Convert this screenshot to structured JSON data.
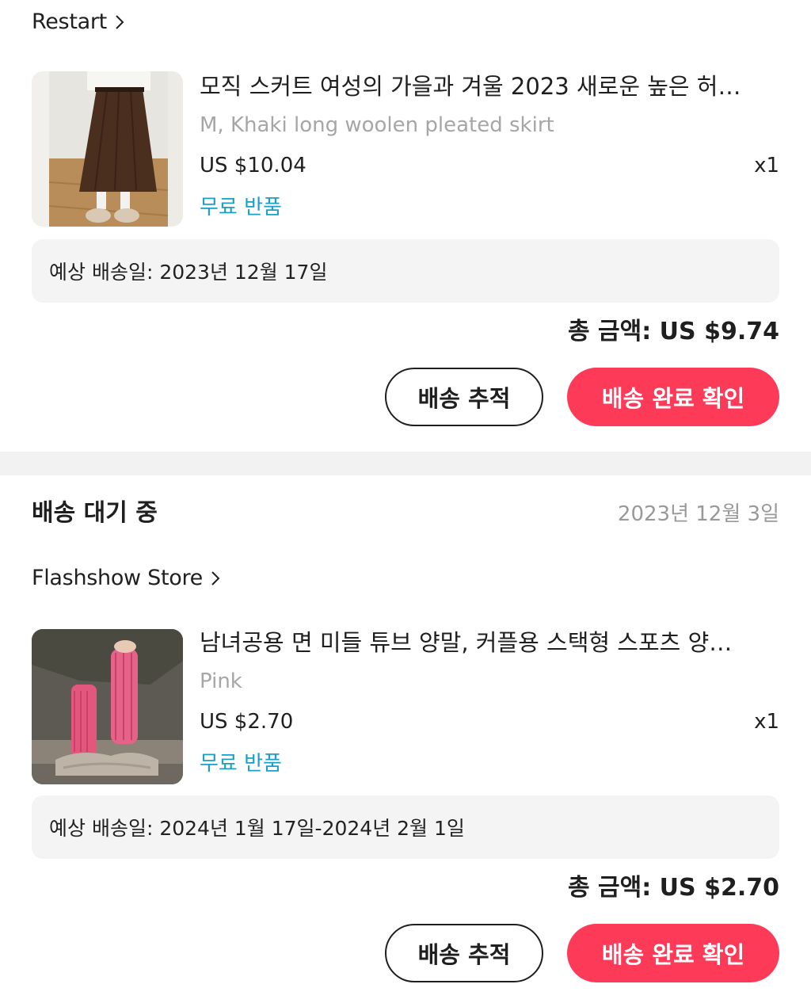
{
  "orders": [
    {
      "store": "Restart",
      "product": {
        "title": "모직 스커트 여성의 가을과 겨울 2023 새로운 높은 허…",
        "variant": "M, Khaki long woolen pleated skirt",
        "price": "US $10.04",
        "quantity": "x1",
        "free_return": "무료 반품",
        "image": "brown-pleated-skirt-photo"
      },
      "delivery_estimate": "예상 배송일: 2023년 12월 17일",
      "total": "총 금액: US $9.74",
      "track_button": "배송 추적",
      "confirm_button": "배송 완료 확인"
    },
    {
      "status": "배송 대기 중",
      "order_date": "2023년 12월 3일",
      "store": "Flashshow Store",
      "product": {
        "title": "남녀공용 면 미들 튜브 양말, 커플용 스택형 스포츠 양…",
        "variant": "Pink",
        "price": "US $2.70",
        "quantity": "x1",
        "free_return": "무료 반품",
        "image": "pink-socks-photo"
      },
      "delivery_estimate": "예상 배송일: 2024년 1월 17일-2024년 2월 1일",
      "total": "총 금액: US $2.70",
      "track_button": "배송 추적",
      "confirm_button": "배송 완료 확인"
    }
  ],
  "colors": {
    "primary": "#fd3a57",
    "free_return": "#1aa0c4",
    "muted": "#a6a6a6",
    "box_bg": "#f4f4f4",
    "separator": "#f2f2f2"
  },
  "icons": {
    "store_chevron": "chevron-right-icon"
  }
}
